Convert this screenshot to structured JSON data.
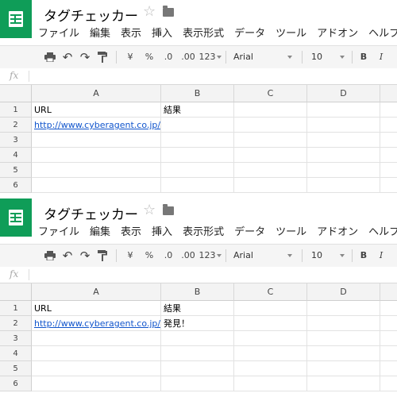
{
  "colors": {
    "brand": "#0f9d58",
    "link": "#1155cc"
  },
  "panels": [
    {
      "title": "タグチェッカー",
      "star_icon": "star-outline-icon",
      "folder_icon": "folder-icon",
      "menu": [
        "ファイル",
        "編集",
        "表示",
        "挿入",
        "表示形式",
        "データ",
        "ツール",
        "アドオン",
        "ヘルプ"
      ],
      "toolbar": {
        "print_icon": "print-icon",
        "undo_icon": "undo-icon",
        "redo_icon": "redo-icon",
        "paint_format_icon": "paint-format-icon",
        "currency": "¥",
        "percent": "%",
        "decrease_decimal": ".0",
        "increase_decimal": ".00",
        "more_formats": "123",
        "font": "Arial",
        "font_size": "10",
        "bold": "B",
        "italic": "I"
      },
      "fx_label": "fx",
      "columns": [
        "A",
        "B",
        "C",
        "D"
      ],
      "rows": [
        "1",
        "2",
        "3",
        "4",
        "5",
        "6"
      ],
      "cells": {
        "A1": "URL",
        "B1": "結果",
        "A2": "http://www.cyberagent.co.jp/",
        "B2": ""
      }
    },
    {
      "title": "タグチェッカー",
      "star_icon": "star-outline-icon",
      "folder_icon": "folder-icon",
      "menu": [
        "ファイル",
        "編集",
        "表示",
        "挿入",
        "表示形式",
        "データ",
        "ツール",
        "アドオン",
        "ヘルプ"
      ],
      "toolbar": {
        "print_icon": "print-icon",
        "undo_icon": "undo-icon",
        "redo_icon": "redo-icon",
        "paint_format_icon": "paint-format-icon",
        "currency": "¥",
        "percent": "%",
        "decrease_decimal": ".0",
        "increase_decimal": ".00",
        "more_formats": "123",
        "font": "Arial",
        "font_size": "10",
        "bold": "B",
        "italic": "I"
      },
      "fx_label": "fx",
      "columns": [
        "A",
        "B",
        "C",
        "D"
      ],
      "rows": [
        "1",
        "2",
        "3",
        "4",
        "5",
        "6"
      ],
      "cells": {
        "A1": "URL",
        "B1": "結果",
        "A2": "http://www.cyberagent.co.jp/",
        "B2": "発見！"
      }
    }
  ]
}
